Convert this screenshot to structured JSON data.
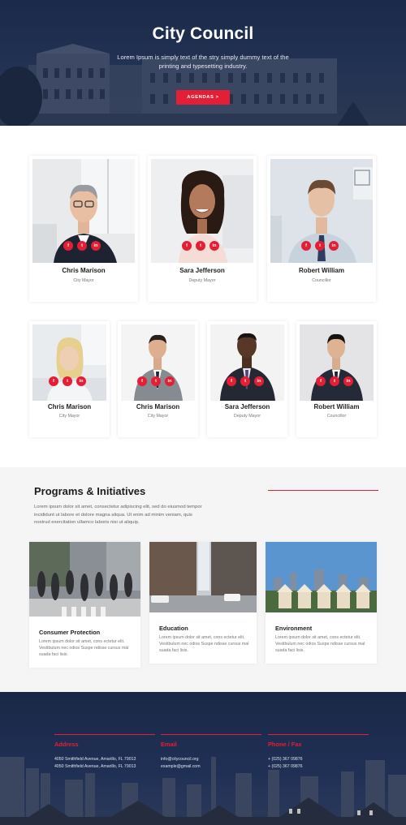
{
  "hero": {
    "title": "City Council",
    "subtitle": "Lorem Ipsum is simply text of the stry simply dummy text of the printing and typesetting industry.",
    "button_label": "AGENDAS >"
  },
  "social_icons": {
    "facebook": "f",
    "twitter": "t",
    "linkedin": "in"
  },
  "team_row1": [
    {
      "name": "Chris Marison",
      "role": "City Mayor"
    },
    {
      "name": "Sara Jefferson",
      "role": "Deputy Mayor"
    },
    {
      "name": "Robert William",
      "role": "Councillor"
    }
  ],
  "team_row2": [
    {
      "name": "Chris Marison",
      "role": "City Mayor"
    },
    {
      "name": "Chris Marison",
      "role": "City Mayor"
    },
    {
      "name": "Sara Jefferson",
      "role": "Deputy Mayor"
    },
    {
      "name": "Robert William",
      "role": "Councillor"
    }
  ],
  "programs": {
    "title": "Programs & Initiatives",
    "description": "Lorem ipsum dolor sit amet, consectetur adipiscing elit, sed do eiusmod tempor incididunt ut labore et dolore magna aliqua. Ut enim ad minim veniam, quis nostrud exercitation ullamco laboris nisi ut aliquip.",
    "items": [
      {
        "title": "Consumer Protection",
        "text": "Lorem ipsum dolor sit amet, cons ectetur elit. Vestibulum nec odios Suspe ndisse cursus mal suada faci lisis."
      },
      {
        "title": "Education",
        "text": "Lorem ipsum dolor sit amet, cons ectetur elit. Vestibulum nec odios Suspe ndisse cursus mal suada faci lisis."
      },
      {
        "title": "Environment",
        "text": "Lorem ipsum dolor sit amet, cons ectetur elit. Vestibulum nec odios Suspe ndisse cursus mal suada faci lisis."
      }
    ]
  },
  "footer": {
    "address": {
      "heading": "Address",
      "line1": "4050 Smithfield Avenue, Amarillo, FL 79013",
      "line2": "4050 Smithfield Avenue, Amarillo, FL 79013"
    },
    "email": {
      "heading": "Email",
      "line1": "info@citycouncil.org",
      "line2": "example@gmail.com"
    },
    "phone": {
      "heading": "Phone / Fax",
      "line1": "+ (025) 367 09876",
      "line2": "+ (025) 367 09876"
    }
  },
  "colors": {
    "accent": "#e41f35",
    "hero_bg": "#1f3053",
    "footer_bg": "#1a2847"
  }
}
